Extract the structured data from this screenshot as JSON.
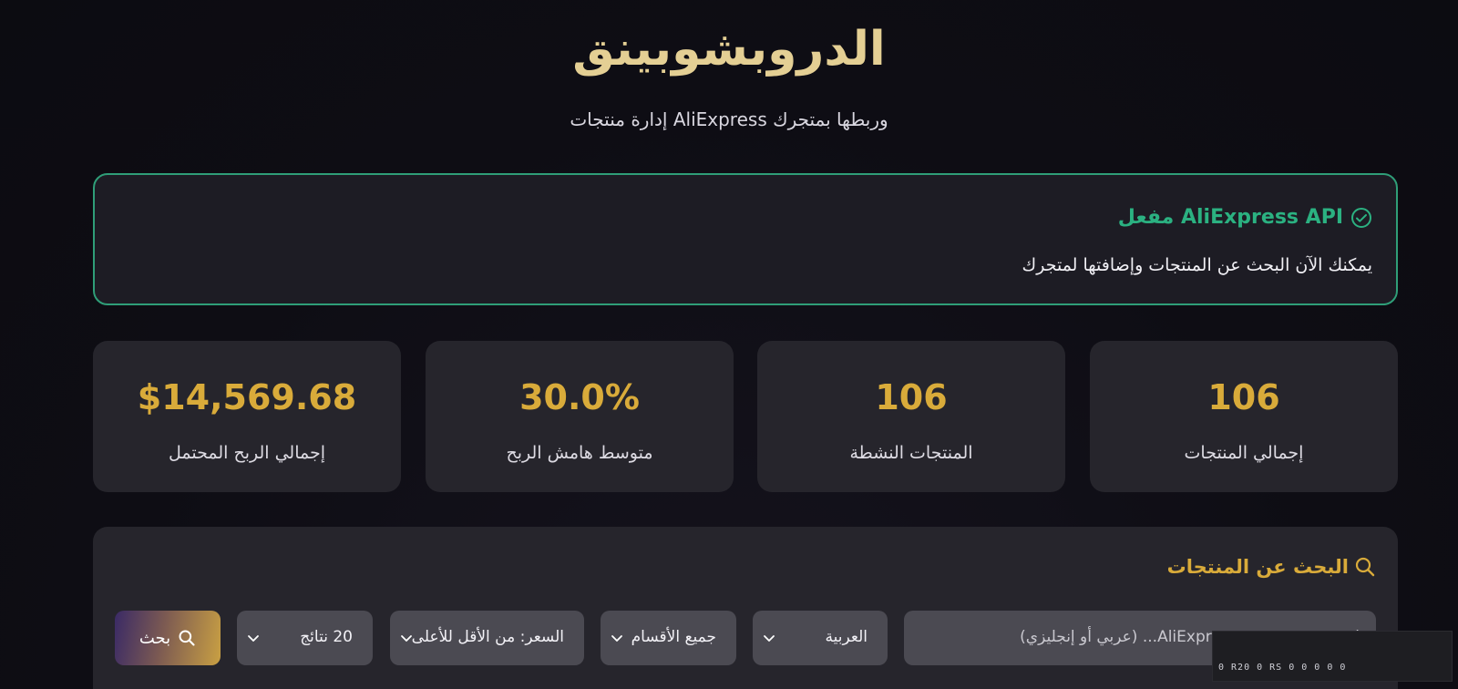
{
  "header": {
    "title": "الدروبشوبينق",
    "subtitle": "إدارة منتجات AliExpress وربطها بمتجرك"
  },
  "api_status": {
    "title": "AliExpress API مفعل",
    "description": "يمكنك الآن البحث عن المنتجات وإضافتها لمتجرك",
    "icon": "check-circle-icon",
    "color": "#2bb181"
  },
  "stats": [
    {
      "label": "إجمالي المنتجات",
      "value": "106"
    },
    {
      "label": "المنتجات النشطة",
      "value": "106"
    },
    {
      "label": "متوسط هامش الربح",
      "value": "30.0%"
    },
    {
      "label": "إجمالي الربح المحتمل",
      "value": "$14,569.68"
    }
  ],
  "search": {
    "title": "البحث عن المنتجات",
    "input_placeholder": "ابحث عن منتج في AliExpress... (عربي أو إنجليزي)",
    "language_value": "العربية",
    "category_value": "جميع الأقسام",
    "sort_value": "السعر: من الأقل للأعلى",
    "results_value": "20 نتائج",
    "button_label": "بحث"
  },
  "overlay": {
    "text": "0 R20 0 RS 0 0 0 0 0"
  },
  "colors": {
    "accent_gold": "#d9ab3a",
    "title_gold": "#e4cf94",
    "success_green": "#2bb181"
  }
}
